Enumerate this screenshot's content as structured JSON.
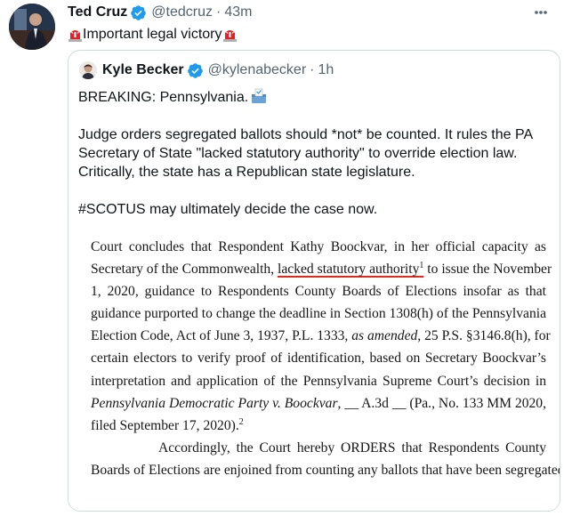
{
  "tweet": {
    "author_name": "Ted Cruz",
    "author_handle": "@tedcruz",
    "separator": "·",
    "timestamp": "43m",
    "text": "Important legal victory",
    "emoji": "siren-emoji",
    "avatar_icon": "user-avatar-photo",
    "more_icon": "more-options-icon"
  },
  "quoted_tweet": {
    "author_name": "Kyle Becker",
    "author_handle": "@kylenabecker",
    "separator": "·",
    "timestamp": "1h",
    "line1": "BREAKING: Pennsylvania.",
    "line1_emoji": "ballot-box-emoji",
    "paragraph2": "Judge orders segregated ballots should *not* be counted. It rules the PA Secretary of State \"lacked statutory authority\" to override election law. Critically, the state has a Republican state legislature.",
    "paragraph3": "#SCOTUS may ultimately decide the case now.",
    "document": {
      "l1": "Court concludes that Respondent Kathy Boockvar, in her official capacity as",
      "l2a": "Secretary of the Commonwealth,",
      "l2_underlined": "lacked statutory authority",
      "l2_sup": "1",
      "l2b": "to issue the November",
      "l3": "1, 2020, guidance to Respondents County Boards of Elections insofar as that",
      "l4": "guidance purported to change the deadline in Section 1308(h) of the Pennsylvania",
      "l5a": "Election Code, Act of June 3, 1937, P.L. 1333,",
      "l5_italic": "as amended",
      "l5b": ", 25 P.S. §3146.8(h), for",
      "l6": "certain electors to verify proof of identification, based on Secretary Boockvar’s",
      "l7": "interpretation and application of the Pennsylvania Supreme Court’s decision in",
      "l8_italic": "Pennsylvania Democratic Party v. Boockvar",
      "l8b": ", __ A.3d __ (Pa., No. 133 MM 2020,",
      "l9": "filed September 17, 2020).",
      "l9_sup": "2",
      "l10": "Accordingly, the Court hereby ORDERS that Respondents County",
      "l11": "Boards of Elections are enjoined from counting any ballots that have been segregated"
    },
    "underline_color": "#e0281f"
  },
  "colors": {
    "verified": "#1d9bf0",
    "text_primary": "#0f1419",
    "text_secondary": "#536471",
    "border": "#cfd9de"
  }
}
